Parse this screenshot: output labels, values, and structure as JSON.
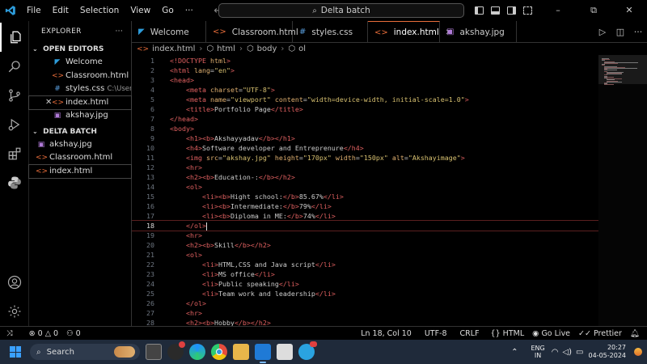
{
  "menu": [
    "File",
    "Edit",
    "Selection",
    "View",
    "Go",
    "···"
  ],
  "search_text": "Delta batch",
  "window_controls": {
    "minimize": "–",
    "restore": "⧉",
    "close": "✕"
  },
  "explorer": {
    "title": "EXPLORER",
    "more": "···",
    "open_editors": {
      "title": "OPEN EDITORS",
      "items": [
        {
          "label": "Welcome",
          "desc": "",
          "icon": "vscode-icon"
        },
        {
          "label": "Classroom.html",
          "desc": "",
          "icon": "html-icon"
        },
        {
          "label": "styles.css",
          "desc": "C:\\User...",
          "icon": "css-icon"
        },
        {
          "label": "index.html",
          "desc": "",
          "icon": "html-icon"
        },
        {
          "label": "akshay.jpg",
          "desc": "",
          "icon": "image-icon"
        }
      ]
    },
    "folder": {
      "title": "DELTA BATCH",
      "items": [
        {
          "label": "akshay.jpg",
          "icon": "image-icon"
        },
        {
          "label": "Classroom.html",
          "icon": "html-icon"
        },
        {
          "label": "index.html",
          "icon": "html-icon"
        }
      ]
    }
  },
  "tabs": [
    {
      "label": "Welcome",
      "icon": "vscode-icon",
      "active": false
    },
    {
      "label": "Classroom.html",
      "icon": "html-icon",
      "active": false
    },
    {
      "label": "styles.css",
      "icon": "css-icon",
      "active": false
    },
    {
      "label": "index.html",
      "icon": "html-icon",
      "active": true
    },
    {
      "label": "akshay.jpg",
      "icon": "image-icon",
      "active": false
    }
  ],
  "breadcrumb": [
    "index.html",
    "html",
    "body",
    "ol"
  ],
  "code_lines": [
    [
      {
        "c": "t",
        "v": "<!DOCTYPE "
      },
      {
        "c": "a",
        "v": "html"
      },
      {
        "c": "t",
        "v": ">"
      }
    ],
    [
      {
        "c": "t",
        "v": "<html "
      },
      {
        "c": "a",
        "v": "lang"
      },
      {
        "c": "txt",
        "v": "="
      },
      {
        "c": "s",
        "v": "\"en\""
      },
      {
        "c": "t",
        "v": ">"
      }
    ],
    [
      {
        "c": "t",
        "v": "<head>"
      }
    ],
    [
      {
        "c": "txt",
        "v": "    "
      },
      {
        "c": "t",
        "v": "<meta "
      },
      {
        "c": "a",
        "v": "charset"
      },
      {
        "c": "txt",
        "v": "="
      },
      {
        "c": "s",
        "v": "\"UTF-8\""
      },
      {
        "c": "t",
        "v": ">"
      }
    ],
    [
      {
        "c": "txt",
        "v": "    "
      },
      {
        "c": "t",
        "v": "<meta "
      },
      {
        "c": "a",
        "v": "name"
      },
      {
        "c": "txt",
        "v": "="
      },
      {
        "c": "s",
        "v": "\"viewport\""
      },
      {
        "c": "txt",
        "v": " "
      },
      {
        "c": "a",
        "v": "content"
      },
      {
        "c": "txt",
        "v": "="
      },
      {
        "c": "s",
        "v": "\"width=device-width, initial-scale=1.0\""
      },
      {
        "c": "t",
        "v": ">"
      }
    ],
    [
      {
        "c": "txt",
        "v": "    "
      },
      {
        "c": "t",
        "v": "<title>"
      },
      {
        "c": "txt",
        "v": "Portfolio Page"
      },
      {
        "c": "t",
        "v": "</title>"
      }
    ],
    [
      {
        "c": "t",
        "v": "</head>"
      }
    ],
    [
      {
        "c": "t",
        "v": "<body>"
      }
    ],
    [
      {
        "c": "txt",
        "v": "    "
      },
      {
        "c": "t",
        "v": "<h1><b>"
      },
      {
        "c": "txt",
        "v": "Akshayyadav"
      },
      {
        "c": "t",
        "v": "</b></h1>"
      }
    ],
    [
      {
        "c": "txt",
        "v": "    "
      },
      {
        "c": "t",
        "v": "<h4>"
      },
      {
        "c": "txt",
        "v": "Software developer and Entreprenure"
      },
      {
        "c": "t",
        "v": "</h4>"
      }
    ],
    [
      {
        "c": "txt",
        "v": "    "
      },
      {
        "c": "t",
        "v": "<img "
      },
      {
        "c": "a",
        "v": "src"
      },
      {
        "c": "txt",
        "v": "="
      },
      {
        "c": "s",
        "v": "\"akshay.jpg\""
      },
      {
        "c": "txt",
        "v": " "
      },
      {
        "c": "a",
        "v": "height"
      },
      {
        "c": "txt",
        "v": "="
      },
      {
        "c": "s",
        "v": "\"170px\""
      },
      {
        "c": "txt",
        "v": " "
      },
      {
        "c": "a",
        "v": "width"
      },
      {
        "c": "txt",
        "v": "="
      },
      {
        "c": "s",
        "v": "\"150px\""
      },
      {
        "c": "txt",
        "v": " "
      },
      {
        "c": "a",
        "v": "alt"
      },
      {
        "c": "txt",
        "v": "="
      },
      {
        "c": "s",
        "v": "\"Akshayimage\""
      },
      {
        "c": "t",
        "v": ">"
      }
    ],
    [
      {
        "c": "txt",
        "v": "    "
      },
      {
        "c": "t",
        "v": "<hr>"
      }
    ],
    [
      {
        "c": "txt",
        "v": "    "
      },
      {
        "c": "t",
        "v": "<h2><b>"
      },
      {
        "c": "txt",
        "v": "Education-:"
      },
      {
        "c": "t",
        "v": "</b></h2>"
      }
    ],
    [
      {
        "c": "txt",
        "v": "    "
      },
      {
        "c": "t",
        "v": "<ol>"
      }
    ],
    [
      {
        "c": "txt",
        "v": "        "
      },
      {
        "c": "t",
        "v": "<li><b>"
      },
      {
        "c": "txt",
        "v": "Hight school:"
      },
      {
        "c": "t",
        "v": "</b>"
      },
      {
        "c": "txt",
        "v": "85.67%"
      },
      {
        "c": "t",
        "v": "</li>"
      }
    ],
    [
      {
        "c": "txt",
        "v": "        "
      },
      {
        "c": "t",
        "v": "<li><b>"
      },
      {
        "c": "txt",
        "v": "Intermediate:"
      },
      {
        "c": "t",
        "v": "</b>"
      },
      {
        "c": "txt",
        "v": "79%"
      },
      {
        "c": "t",
        "v": "</li>"
      }
    ],
    [
      {
        "c": "txt",
        "v": "        "
      },
      {
        "c": "t",
        "v": "<li><b>"
      },
      {
        "c": "txt",
        "v": "Diploma in ME:"
      },
      {
        "c": "t",
        "v": "</b>"
      },
      {
        "c": "txt",
        "v": "74%"
      },
      {
        "c": "t",
        "v": "</li>"
      }
    ],
    [
      {
        "c": "txt",
        "v": "    "
      },
      {
        "c": "t",
        "v": "</ol>"
      }
    ],
    [
      {
        "c": "txt",
        "v": "    "
      },
      {
        "c": "t",
        "v": "<hr>"
      }
    ],
    [
      {
        "c": "txt",
        "v": "    "
      },
      {
        "c": "t",
        "v": "<h2><b>"
      },
      {
        "c": "txt",
        "v": "Skill"
      },
      {
        "c": "t",
        "v": "</b></h2>"
      }
    ],
    [
      {
        "c": "txt",
        "v": "    "
      },
      {
        "c": "t",
        "v": "<ol>"
      }
    ],
    [
      {
        "c": "txt",
        "v": "        "
      },
      {
        "c": "t",
        "v": "<li>"
      },
      {
        "c": "txt",
        "v": "HTML,CSS and Java script"
      },
      {
        "c": "t",
        "v": "</li>"
      }
    ],
    [
      {
        "c": "txt",
        "v": "        "
      },
      {
        "c": "t",
        "v": "<li>"
      },
      {
        "c": "txt",
        "v": "MS office"
      },
      {
        "c": "t",
        "v": "</li>"
      }
    ],
    [
      {
        "c": "txt",
        "v": "        "
      },
      {
        "c": "t",
        "v": "<li>"
      },
      {
        "c": "txt",
        "v": "Public speaking"
      },
      {
        "c": "t",
        "v": "</li>"
      }
    ],
    [
      {
        "c": "txt",
        "v": "        "
      },
      {
        "c": "t",
        "v": "<li>"
      },
      {
        "c": "txt",
        "v": "Team work and leadership"
      },
      {
        "c": "t",
        "v": "</li>"
      }
    ],
    [
      {
        "c": "txt",
        "v": "    "
      },
      {
        "c": "t",
        "v": "</ol>"
      }
    ],
    [
      {
        "c": "txt",
        "v": "    "
      },
      {
        "c": "t",
        "v": "<hr>"
      }
    ],
    [
      {
        "c": "txt",
        "v": "    "
      },
      {
        "c": "t",
        "v": "<h2><b>"
      },
      {
        "c": "txt",
        "v": "Hobby"
      },
      {
        "c": "t",
        "v": "</b></h2>"
      }
    ]
  ],
  "current_line": 18,
  "status": {
    "errors": "0",
    "warnings": "0",
    "ports": "0",
    "position": "Ln 18, Col 10",
    "encoding": "UTF-8",
    "eol": "CRLF",
    "language": "HTML",
    "golive": "Go Live",
    "prettier": "Prettier"
  },
  "taskbar": {
    "search": "Search",
    "lang_top": "ENG",
    "lang_bottom": "IN",
    "time": "20:27",
    "date": "04-05-2024"
  },
  "colors": {
    "tag": "#e06060",
    "attr": "#e0b070",
    "string": "#d7c070",
    "active_tab_border": "#e86d3a",
    "accent_blue": "#3aa0ff"
  }
}
